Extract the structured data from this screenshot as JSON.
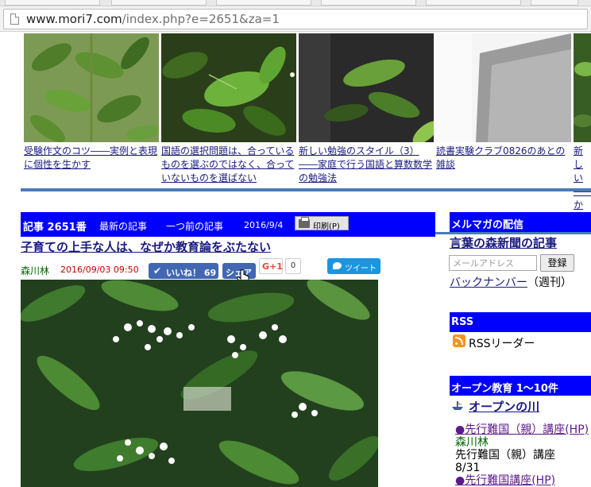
{
  "browser": {
    "url_host": "www.mori7.com",
    "url_path": "/index.php?e=2651&za=1"
  },
  "thumbnails": [
    {
      "caption": "受験作文のコツ――実例と表現に個性を生かす"
    },
    {
      "caption": "国語の選択問題は、合っているものを選ぶのではなく、合っていないものを選ばない"
    },
    {
      "caption": "新しい勉強のスタイル（3）――家庭で行う国語と算数数学の勉強法"
    },
    {
      "caption": "読書実験クラブ0826のあとの雑談"
    },
    {
      "caption": "新しい――から"
    }
  ],
  "article": {
    "number_label": "記事 2651番",
    "latest_link": "最新の記事",
    "prev_link": "一つ前の記事",
    "date_short": "2016/9/4",
    "print_label": "印刷(P)",
    "title": "子育ての上手な人は、なぜか教育論をぶたない",
    "author": "森川林",
    "timestamp": "2016/09/03 09:50",
    "like_label": "いいね！ 69",
    "share_label": "シェア",
    "gplus_label": "G+1",
    "gplus_count": "0",
    "tweet_label": "ツイート"
  },
  "sidebar": {
    "mailmag_header": "メルマガの配信",
    "mailmag_title": "言葉の森新聞の記事",
    "email_placeholder": "メールアドレス",
    "register_button": "登録",
    "backnumber_link": "バックナンバー",
    "backnumber_note": "（週刊）",
    "rss_header": "RSS",
    "rss_reader": "RSSリーダー",
    "open_header": "オープン教育 1〜10件",
    "open_river": "オープンの川",
    "items": [
      {
        "link": "●先行難国（親）講座(HP)",
        "author": "森川林",
        "title": "先行難国（親）講座",
        "date": "8/31"
      },
      {
        "link": "●先行難国講座(HP)"
      }
    ]
  },
  "colors": {
    "header_blue": "#0000ff",
    "link_navy": "#1a1a80",
    "rule_blue": "#4a7cb8",
    "date_red": "#cc0000",
    "author_green": "#006400",
    "facebook_blue": "#4267b2",
    "twitter_blue": "#1b95e0"
  }
}
